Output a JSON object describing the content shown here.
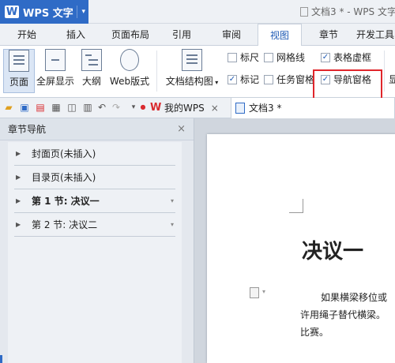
{
  "app": {
    "logo": "W",
    "name": "WPS 文字",
    "menu_caret": "▾"
  },
  "title_bar": {
    "document_title": "文档3 * - WPS 文字"
  },
  "menu_tabs": [
    "开始",
    "插入",
    "页面布局",
    "引用",
    "审阅",
    "视图",
    "章节",
    "开发工具"
  ],
  "active_tab": "视图",
  "ribbon": {
    "buttons": [
      {
        "label": "页面",
        "icon": "page-view-icon",
        "active": true
      },
      {
        "label": "全屏显示",
        "icon": "fullscreen-icon"
      },
      {
        "label": "大纲",
        "icon": "outline-icon"
      },
      {
        "label": "Web版式",
        "icon": "web-layout-icon"
      },
      {
        "label": "文档结构图",
        "icon": "doc-structure-icon",
        "has_dropdown": true
      }
    ],
    "checkboxes": [
      {
        "label": "标尺",
        "checked": false
      },
      {
        "label": "网格线",
        "checked": false
      },
      {
        "label": "表格虚框",
        "checked": true
      },
      {
        "label": "标记",
        "checked": true
      },
      {
        "label": "任务窗格",
        "checked": false
      },
      {
        "label": "导航窗格",
        "checked": true
      }
    ],
    "cut_off_label": "显",
    "check_mark": "✓"
  },
  "quick_toolbar": {
    "tabs": [
      {
        "label": "我的WPS",
        "icon": "wps-logo-icon"
      },
      {
        "label": "文档3 *",
        "icon": "document-icon"
      }
    ],
    "close_glyph": "×"
  },
  "nav_pane": {
    "title": "章节导航",
    "close_glyph": "×",
    "items": [
      {
        "label": "封面页(未插入)",
        "bold": false,
        "has_caret": false
      },
      {
        "label": "目录页(未插入)",
        "bold": false,
        "has_caret": false
      },
      {
        "label": "第 1 节: 决议一",
        "bold": true,
        "has_caret": true
      },
      {
        "label": "第 2 节: 决议二",
        "bold": false,
        "has_caret": true
      }
    ],
    "arrow_glyph": "▶",
    "caret_glyph": "▾"
  },
  "document": {
    "heading": "决议一",
    "paragraph_lines": [
      "如果横梁移位或",
      "许用绳子替代横梁。",
      "比赛。"
    ]
  },
  "colors": {
    "accent": "#2f6bc6",
    "highlight_box": "#e0262b",
    "wps_red": "#d92b2f"
  }
}
